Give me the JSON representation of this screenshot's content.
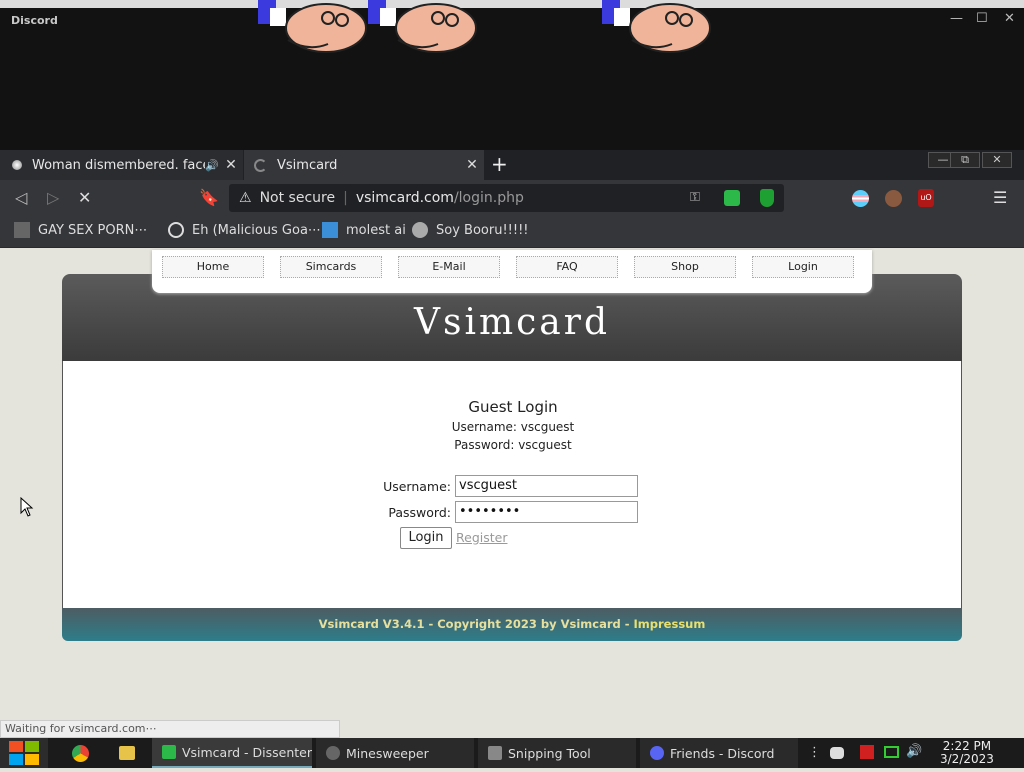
{
  "discord": {
    "title": "Discord",
    "minimize": "—",
    "maximize": "☐",
    "close": "✕"
  },
  "browser": {
    "tabs": [
      {
        "label": "Woman dismembered. face c",
        "close": "✕"
      },
      {
        "label": "Vsimcard",
        "close": "✕"
      }
    ],
    "new_tab": "+",
    "window_controls": {
      "minimize": "—",
      "restore": "⧉",
      "close": "✕"
    },
    "address": {
      "security": "Not secure",
      "host": "vsimcard.com",
      "path": "/login.php"
    },
    "bookmarks": [
      "GAY SEX PORN⋯",
      "Eh (Malicious Goa⋯",
      "molest ai",
      "Soy Booru!!!!!"
    ],
    "status": "Waiting for vsimcard.com⋯",
    "menu": "☰"
  },
  "page": {
    "nav": [
      "Home",
      "Simcards",
      "E-Mail",
      "FAQ",
      "Shop",
      "Login"
    ],
    "site_title": "Vsimcard",
    "guest": {
      "title": "Guest Login",
      "username_line": "Username:  vscguest",
      "password_line": "Password:  vscguest"
    },
    "form": {
      "username_label": "Username:",
      "username_value": "vscguest",
      "password_label": "Password:",
      "password_value": "••••••••",
      "login_button": "Login",
      "register_link": "Register"
    },
    "footer": {
      "text": "Vsimcard V3.4.1 - Copyright 2023 by Vsimcard - ",
      "impressum": "Impressum"
    }
  },
  "taskbar": {
    "items": [
      "Vsimcard - Dissenter",
      "Minesweeper",
      "Snipping Tool",
      "Friends - Discord"
    ],
    "time": "2:22 PM",
    "date": "3/2/2023"
  }
}
